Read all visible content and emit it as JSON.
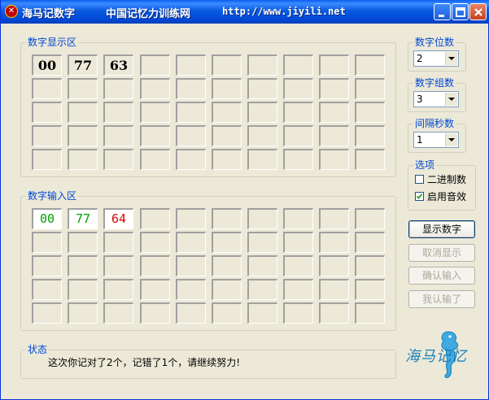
{
  "window": {
    "app_name": "海马记数字",
    "site_name": "中国记忆力训练网",
    "url": "http://www.jiyili.net"
  },
  "display_group": {
    "label": "数字显示区",
    "rows": [
      [
        "00",
        "77",
        "63",
        "",
        "",
        "",
        "",
        "",
        "",
        ""
      ],
      [
        "",
        "",
        "",
        "",
        "",
        "",
        "",
        "",
        "",
        ""
      ],
      [
        "",
        "",
        "",
        "",
        "",
        "",
        "",
        "",
        "",
        ""
      ],
      [
        "",
        "",
        "",
        "",
        "",
        "",
        "",
        "",
        "",
        ""
      ],
      [
        "",
        "",
        "",
        "",
        "",
        "",
        "",
        "",
        "",
        ""
      ]
    ]
  },
  "input_group": {
    "label": "数字输入区",
    "rows": [
      [
        "00",
        "77",
        "64",
        "",
        "",
        "",
        "",
        "",
        "",
        ""
      ],
      [
        "",
        "",
        "",
        "",
        "",
        "",
        "",
        "",
        "",
        ""
      ],
      [
        "",
        "",
        "",
        "",
        "",
        "",
        "",
        "",
        "",
        ""
      ],
      [
        "",
        "",
        "",
        "",
        "",
        "",
        "",
        "",
        "",
        ""
      ],
      [
        "",
        "",
        "",
        "",
        "",
        "",
        "",
        "",
        "",
        ""
      ]
    ],
    "cell_status": [
      [
        "correct",
        "correct",
        "wrong"
      ]
    ]
  },
  "settings": {
    "digit_count": {
      "label": "数字位数",
      "value": "2"
    },
    "group_count": {
      "label": "数字组数",
      "value": "3"
    },
    "interval": {
      "label": "间隔秒数",
      "value": "1"
    },
    "options": {
      "label": "选项",
      "binary": {
        "label": "二进制数",
        "checked": false
      },
      "sound": {
        "label": "启用音效",
        "checked": true
      }
    }
  },
  "buttons": {
    "show": "显示数字",
    "cancel_show": "取消显示",
    "confirm_input": "确认输入",
    "give_up": "我认输了"
  },
  "status": {
    "label": "状态",
    "message": "这次你记对了2个，记错了1个，请继续努力!"
  },
  "logo": {
    "text": "海马记忆"
  },
  "colors": {
    "correct": "#00A000",
    "wrong": "#E00000",
    "accent": "#0046D5"
  }
}
